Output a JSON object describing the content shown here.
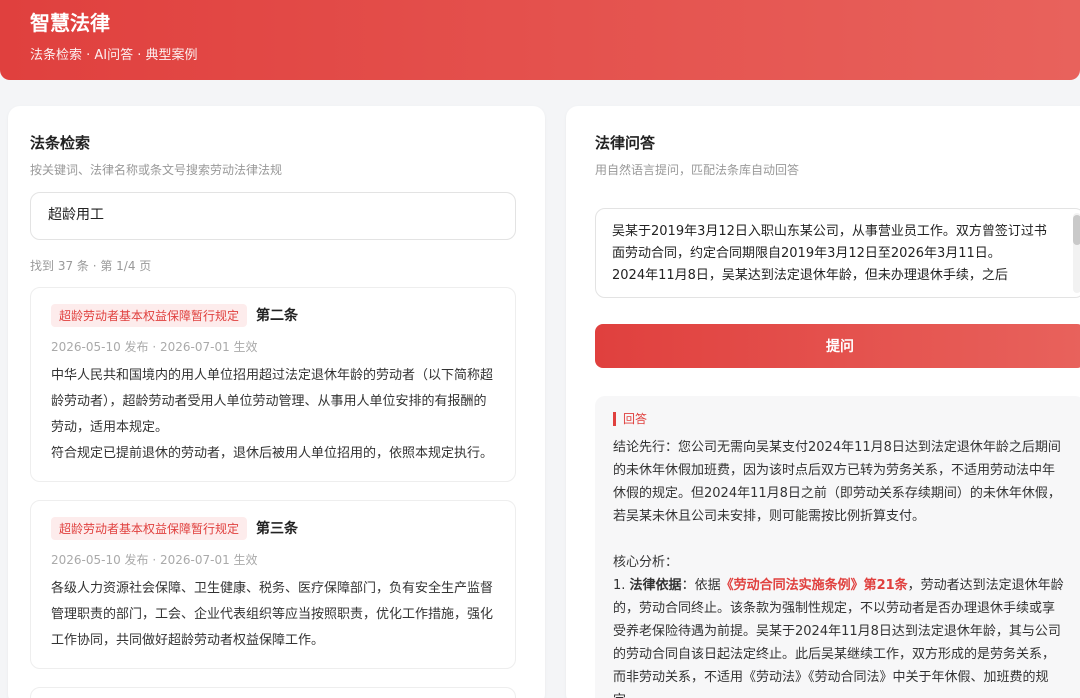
{
  "header": {
    "title": "智慧法律",
    "subtitle": "法条检索 · AI问答 · 典型案例"
  },
  "search_panel": {
    "title": "法条检索",
    "description": "按关键词、法律名称或条文号搜索劳动法律法规",
    "query": "超龄用工",
    "result_count": "找到 37 条 · 第 1/4 页",
    "results": [
      {
        "law": "超龄劳动者基本权益保障暂行规定",
        "article": "第二条",
        "dates": "2026-05-10 发布 · 2026-07-01 生效",
        "paragraphs": [
          "中华人民共和国境内的用人单位招用超过法定退休年龄的劳动者（以下简称超龄劳动者），超龄劳动者受用人单位劳动管理、从事用人单位安排的有报酬的劳动，适用本规定。",
          "符合规定已提前退休的劳动者，退休后被用人单位招用的，依照本规定执行。"
        ]
      },
      {
        "law": "超龄劳动者基本权益保障暂行规定",
        "article": "第三条",
        "dates": "2026-05-10 发布 · 2026-07-01 生效",
        "paragraphs": [
          "各级人力资源社会保障、卫生健康、税务、医疗保障部门，负有安全生产监督管理职责的部门，工会、企业代表组织等应当按照职责，优化工作措施，强化工作协同，共同做好超龄劳动者权益保障工作。"
        ]
      }
    ]
  },
  "qa_panel": {
    "title": "法律问答",
    "description": "用自然语言提问，匹配法条库自动回答",
    "question": "吴某于2019年3月12日入职山东某公司，从事营业员工作。双方曾签订过书面劳动合同，约定合同期限自2019年3月12日至2026年3月11日。\n2024年11月8日，吴某达到法定退休年龄，但未办理退休手续，之后",
    "ask_label": "提问",
    "answer_label": "回答",
    "answer": {
      "conclusion": "结论先行：您公司无需向吴某支付2024年11月8日达到法定退休年龄之后期间的未休年休假加班费，因为该时点后双方已转为劳务关系，不适用劳动法中年休假的规定。但2024年11月8日之前（即劳动关系存续期间）的未休年休假，若吴某未休且公司未安排，则可能需按比例折算支付。",
      "analysis_heading": "核心分析：",
      "point1_prefix": "1. ",
      "point1_label": "法律依据",
      "point1_colon": "：依据",
      "point1_ref": "《劳动合同法实施条例》第21条",
      "point1_text": "，劳动者达到法定退休年龄的，劳动合同终止。该条款为强制性规定，不以劳动者是否办理退休手续或享受养老保险待遇为前提。吴某于2024年11月8日达到法定退休年龄，其与公司的劳动合同自该日起法定终止。此后吴某继续工作，双方形成的是劳务关系，而非劳动关系，不适用《劳动法》《劳动合同法》中关于年休假、加班费的规定。"
    }
  },
  "colors": {
    "accent": "#e0403e",
    "tag_bg": "#fdecec"
  }
}
